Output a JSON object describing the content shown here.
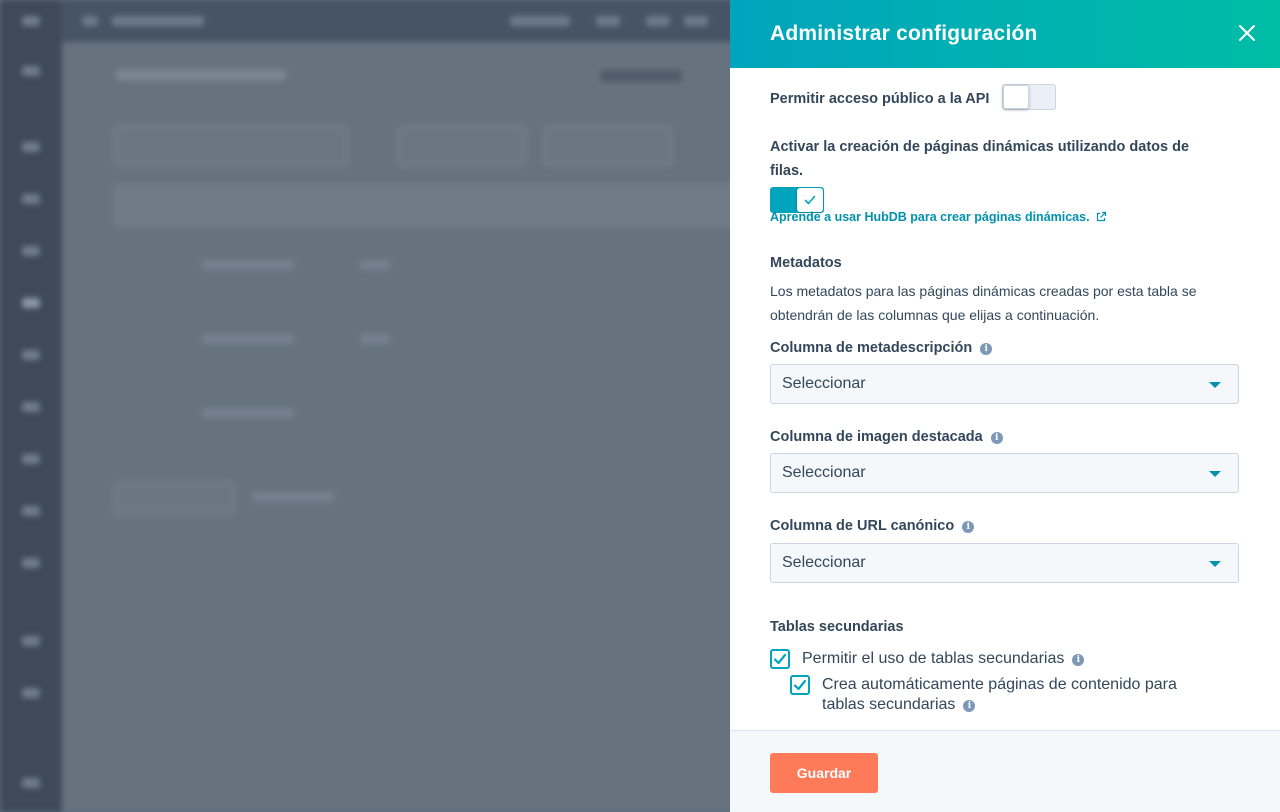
{
  "panel": {
    "title": "Administrar configuración",
    "public_api": {
      "label": "Permitir acceso público a la API",
      "enabled": false
    },
    "dynamic_pages": {
      "label": "Activar la creación de páginas dinámicas utilizando datos de filas.",
      "enabled": true,
      "help_link": "Aprende a usar HubDB para crear páginas dinámicas."
    },
    "metadata": {
      "heading": "Metadatos",
      "description": "Los metadatos para las páginas dinámicas creadas por esta tabla se obtendrán de las columnas que elijas a continuación.",
      "fields": [
        {
          "label": "Columna de metadescripción",
          "value": "Seleccionar"
        },
        {
          "label": "Columna de imagen destacada",
          "value": "Seleccionar"
        },
        {
          "label": "Columna de URL canónico",
          "value": "Seleccionar"
        }
      ]
    },
    "child_tables": {
      "heading": "Tablas secundarias",
      "options": [
        {
          "label": "Permitir el uso de tablas secundarias",
          "checked": true
        },
        {
          "label_line1": "Crea automáticamente páginas de contenido para",
          "label_line2": "tablas secundarias",
          "checked": true
        }
      ]
    },
    "footer": {
      "save_label": "Guardar"
    }
  },
  "colors": {
    "header_gradient_start": "#01a4bd",
    "header_gradient_end": "#00bda5",
    "accent": "#00a4bd",
    "save_button": "#ff7a59",
    "text": "#33475b",
    "overlay_background": "#5c6b7b"
  },
  "icons": {
    "close": "close-icon",
    "external_link": "external-link-icon",
    "info": "info-icon",
    "check": "check-icon",
    "caret": "chevron-down-icon"
  }
}
